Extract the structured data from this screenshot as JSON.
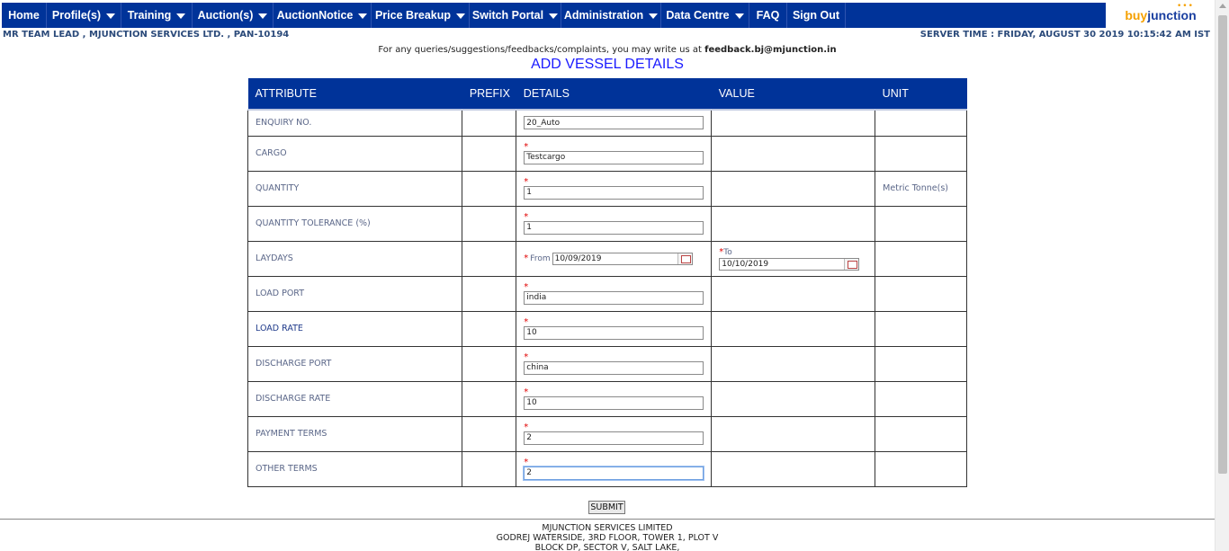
{
  "nav": {
    "items": [
      {
        "label": "Home",
        "dropdown": false
      },
      {
        "label": "Profile(s)",
        "dropdown": true
      },
      {
        "label": "Training",
        "dropdown": true
      },
      {
        "label": "Auction(s)",
        "dropdown": true
      },
      {
        "label": "AuctionNotice",
        "dropdown": true
      },
      {
        "label": "Price Breakup",
        "dropdown": true
      },
      {
        "label": "Switch Portal",
        "dropdown": true
      },
      {
        "label": "Administration",
        "dropdown": true
      },
      {
        "label": "Data Centre",
        "dropdown": true
      },
      {
        "label": "FAQ",
        "dropdown": false
      },
      {
        "label": "Sign Out",
        "dropdown": false
      }
    ],
    "logo_buy": "buy",
    "logo_junction": "junction"
  },
  "header": {
    "user_info": "MR TEAM LEAD , MJUNCTION SERVICES LTD. , PAN-10194",
    "server_time": "SERVER TIME : FRIDAY, AUGUST 30 2019 10:15:42 AM IST",
    "feedback_prefix": "For any queries/suggestions/feedbacks/complaints, you may write us at ",
    "feedback_email": "feedback.bj@mjunction.in",
    "page_title": "ADD VESSEL DETAILS"
  },
  "table": {
    "columns": [
      "ATTRIBUTE",
      "PREFIX",
      "DETAILS",
      "VALUE",
      "UNIT"
    ],
    "rows": {
      "enquiry_no": {
        "label": "ENQUIRY NO.",
        "value": "20_Auto"
      },
      "cargo": {
        "label": "CARGO",
        "value": "Testcargo"
      },
      "quantity": {
        "label": "QUANTITY",
        "value": "1",
        "unit": "Metric Tonne(s)"
      },
      "quantity_tolerance": {
        "label": "QUANTITY TOLERANCE (%)",
        "value": "1"
      },
      "laydays": {
        "label": "LAYDAYS",
        "from_label": "From",
        "from_value": "10/09/2019",
        "to_label": "To",
        "to_value": "10/10/2019"
      },
      "load_port": {
        "label": "LOAD PORT",
        "value": "india"
      },
      "load_rate": {
        "label": "LOAD RATE",
        "value": "10"
      },
      "discharge_port": {
        "label": "DISCHARGE PORT",
        "value": "china"
      },
      "discharge_rate": {
        "label": "DISCHARGE RATE",
        "value": "10"
      },
      "payment_terms": {
        "label": "PAYMENT TERMS",
        "value": "2"
      },
      "other_terms": {
        "label": "OTHER TERMS",
        "value": "2"
      }
    },
    "required_mark": "*"
  },
  "submit_label": "SUBMIT",
  "footer": {
    "line1": "MJUNCTION SERVICES LIMITED",
    "line2": "GODREJ WATERSIDE, 3RD FLOOR, TOWER 1, PLOT V",
    "line3": "BLOCK DP, SECTOR V, SALT LAKE,"
  },
  "colors": {
    "nav_bg": "#003399",
    "heading": "#1a1aff",
    "required": "#e00000",
    "logo_orange": "#f5a000"
  }
}
